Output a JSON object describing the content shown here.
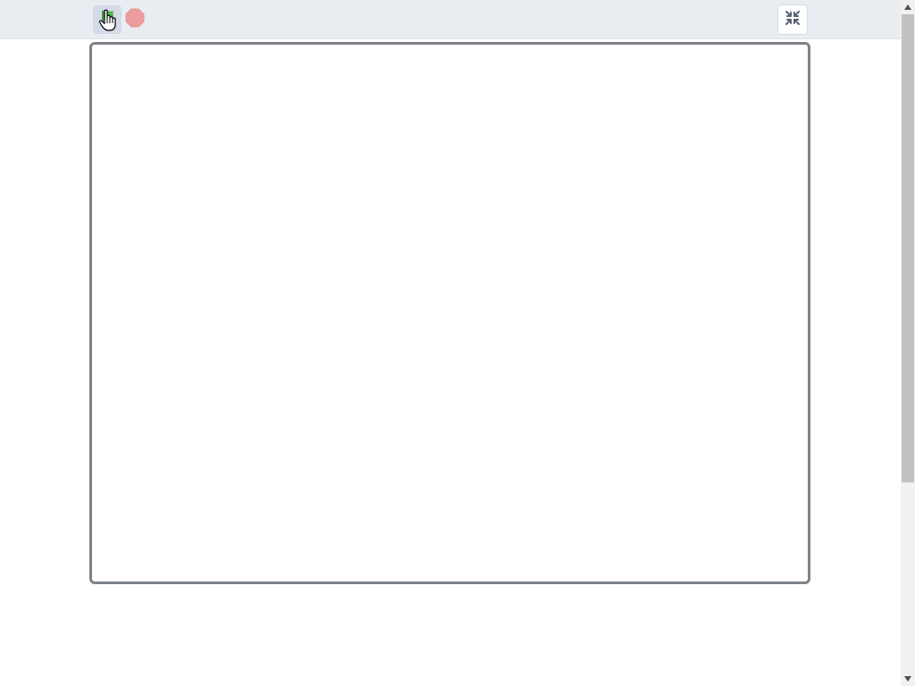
{
  "toolbar": {
    "green_flag": {
      "icon": "green-flag-icon",
      "color": "#4cbf56",
      "state": "hovered"
    },
    "stop": {
      "icon": "stop-sign-icon",
      "color": "#ec9c9e"
    },
    "fullscreen_exit": {
      "icon": "exit-fullscreen-icon"
    },
    "background": "#e9ecf1"
  },
  "stage": {
    "border_color": "#7d8388",
    "background": "#ffffff"
  },
  "scrollbar": {
    "thumb_color": "#c1c1c1",
    "track_color": "#f1f1f1"
  }
}
